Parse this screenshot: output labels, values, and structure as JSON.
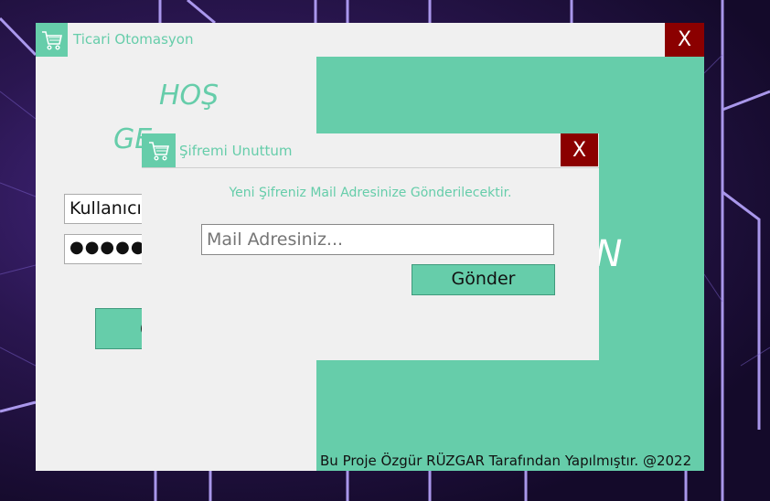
{
  "main_window": {
    "title": "Ticari Otomasyon",
    "close_label": "X",
    "welcome_line1": "HOŞ",
    "welcome_line2": "GE",
    "username_value": "Kullanıcı",
    "password_value": "●●●●●",
    "login_label": "G",
    "big_text": "ON",
    "footer": "Bu Proje Özgür RÜZGAR Tarafından Yapılmıştır. @2022"
  },
  "dialog": {
    "title": "Şifremi Unuttum",
    "close_label": "X",
    "message": "Yeni Şifreniz Mail Adresinize Gönderilecektir.",
    "mail_placeholder": "Mail Adresiniz...",
    "send_label": "Gönder"
  },
  "icons": {
    "app": "shopping-cart-icon"
  },
  "colors": {
    "accent": "#66cdaa",
    "close": "#8b0000"
  }
}
